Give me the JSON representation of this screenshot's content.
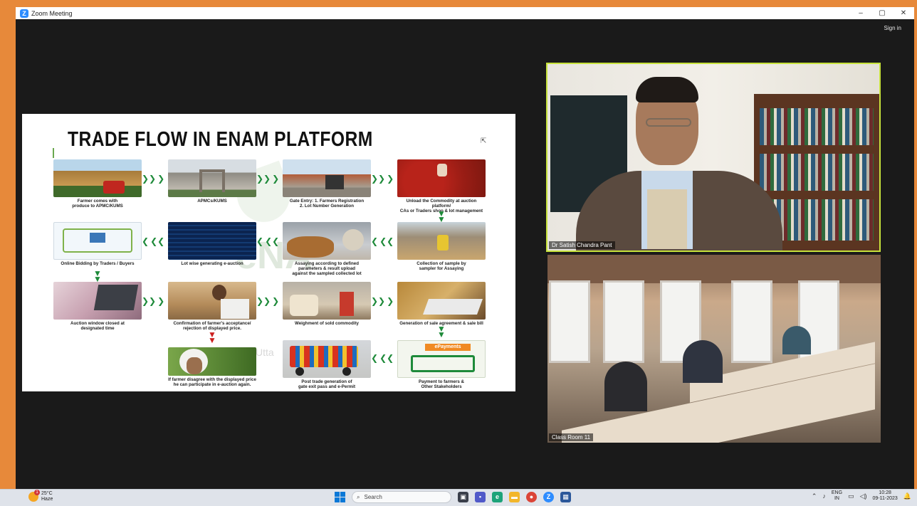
{
  "window": {
    "title": "Zoom Meeting",
    "sign_in": "Sign in",
    "controls": {
      "minimize": "–",
      "maximize": "▢",
      "close": "✕"
    }
  },
  "slide": {
    "title": "TRADE FLOW IN ENAM PLATFORM",
    "watermark": "eNA",
    "watermark2": "Utta",
    "steps": [
      {
        "caption": "Farmer comes with\nproduce to APMC/KUMS"
      },
      {
        "caption": "APMCs/KUMS"
      },
      {
        "caption": "Gate Entry: 1. Farmers Registration\n2. Lot Number Generation"
      },
      {
        "caption": "Unload the Commodity at auction platform/\nCAs or Traders shop & lot management"
      },
      {
        "caption": "Online Bidding by Traders / Buyers"
      },
      {
        "caption": "Lot wise generating e-auction"
      },
      {
        "caption": "Assaying according to defined\nparameters & result upload\nagainst the sampled collected lot"
      },
      {
        "caption": "Collection of sample by\nsampler for Assaying"
      },
      {
        "caption": "Auction window closed at\ndesignated time"
      },
      {
        "caption": "Confirmation of farmer's acceptance/\nrejection of displayed price."
      },
      {
        "caption": "Weighment of sold commodity"
      },
      {
        "caption": "Generation of sale agreement & sale bill"
      },
      {
        "caption": "If farmer disagree with the displayed price\nhe can participate in e-auction again."
      },
      {
        "caption": "Post trade generation of\ngate exit pass and e-Permit"
      },
      {
        "caption": "Payment to farmers &\nOther Stakeholders"
      }
    ],
    "epayments_label": "ePayments"
  },
  "video": {
    "top_name": "Dr Satish Chandra Pant",
    "bottom_name": "Class Room 11"
  },
  "taskbar": {
    "temperature": "25°C",
    "weather": "Haze",
    "weather_badge": "1",
    "search_placeholder": "Search",
    "lang_top": "ENG",
    "lang_bottom": "IN",
    "time": "10:28",
    "date": "09-11-2023"
  }
}
